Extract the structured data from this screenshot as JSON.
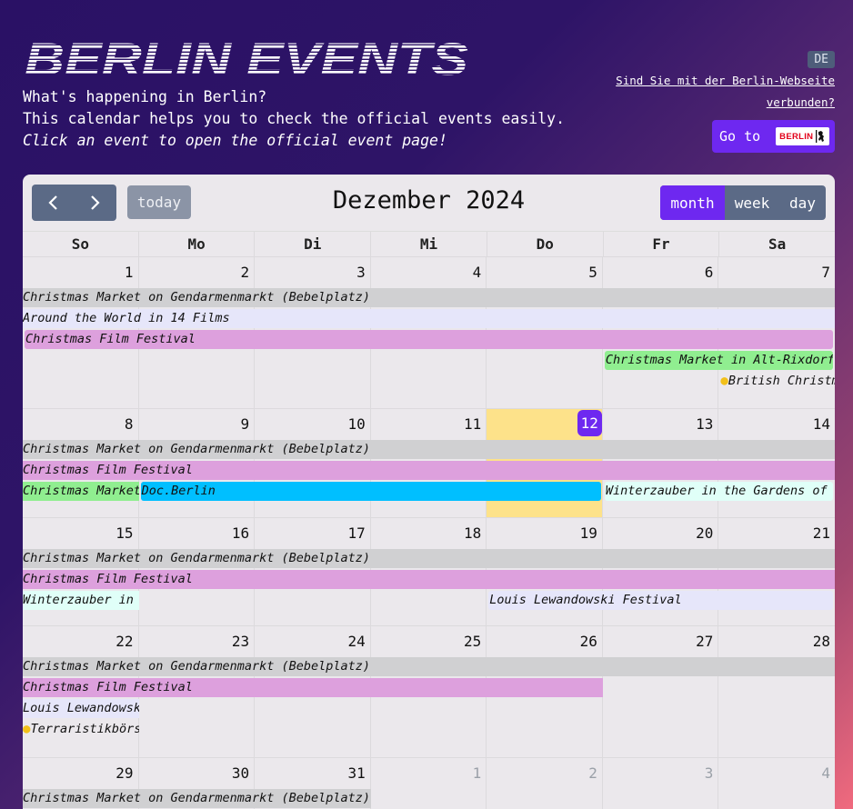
{
  "header": {
    "logo_text": "BERLIN EVENTS",
    "intro_line1": "What's happening in Berlin?",
    "intro_line2": "This calendar helps you to check the official events easily.",
    "intro_line3": "Click an event to open the official event page!",
    "lang": "DE",
    "link_line1": "Sind Sie mit der Berlin-Webseite",
    "link_line2": "verbunden?",
    "goto_label": "Go to",
    "berlin_logo_text": "BERLIN"
  },
  "toolbar": {
    "today_label": "today",
    "title": "Dezember 2024",
    "views": [
      "month",
      "week",
      "day"
    ],
    "active_view": "month"
  },
  "weekdays": [
    "So",
    "Mo",
    "Di",
    "Mi",
    "Do",
    "Fr",
    "Sa"
  ],
  "colors": {
    "accent": "#6e28f0",
    "today_bg": "#fde28a",
    "gray_event": "#d0d0d2",
    "lavender_event": "#e6e6fa",
    "pink_event": "#dda0dd",
    "green_event": "#90ee90",
    "blue_event": "#00bfff",
    "mint_event": "#e0fff8"
  },
  "weeks": [
    {
      "days": [
        {
          "num": "1"
        },
        {
          "num": "2"
        },
        {
          "num": "3"
        },
        {
          "num": "4"
        },
        {
          "num": "5"
        },
        {
          "num": "6"
        },
        {
          "num": "7"
        }
      ],
      "events": [
        {
          "title": "Christmas Market on Gendarmenmarkt (Bebelplatz)",
          "start": 0,
          "end": 7,
          "row": 0,
          "color": "#d0d0d2"
        },
        {
          "title": "Around the World in 14 Films",
          "start": 0,
          "end": 7,
          "row": 1,
          "color": "#e6e6fa"
        },
        {
          "title": "Christmas Film Festival",
          "start": 0,
          "end": 7,
          "row": 2,
          "color": "#dda0dd",
          "inset": true
        },
        {
          "title": "Christmas Market in Alt-Rixdorf",
          "start": 5,
          "end": 7,
          "row": 3,
          "color": "#90ee90",
          "inset": true
        },
        {
          "title": "British Christmas Fair",
          "start": 6,
          "end": 7,
          "row": 4,
          "color": "transparent",
          "dot": true
        }
      ]
    },
    {
      "days": [
        {
          "num": "8"
        },
        {
          "num": "9"
        },
        {
          "num": "10"
        },
        {
          "num": "11"
        },
        {
          "num": "12",
          "today": true
        },
        {
          "num": "13"
        },
        {
          "num": "14"
        }
      ],
      "events": [
        {
          "title": "Christmas Market on Gendarmenmarkt (Bebelplatz)",
          "start": 0,
          "end": 7,
          "row": 0,
          "color": "#d0d0d2"
        },
        {
          "title": "Christmas Film Festival",
          "start": 0,
          "end": 7,
          "row": 1,
          "color": "#dda0dd"
        },
        {
          "title": "Christmas Market in Alt-Rixdorf",
          "start": 0,
          "end": 1,
          "row": 2,
          "color": "#90ee90"
        },
        {
          "title": "Doc.Berlin",
          "start": 1,
          "end": 5,
          "row": 2,
          "color": "#00bfff",
          "inset": true
        },
        {
          "title": "Winterzauber in the Gardens of the World",
          "start": 5,
          "end": 7,
          "row": 2,
          "color": "#e0fff8",
          "inset": true
        }
      ]
    },
    {
      "days": [
        {
          "num": "15"
        },
        {
          "num": "16"
        },
        {
          "num": "17"
        },
        {
          "num": "18"
        },
        {
          "num": "19"
        },
        {
          "num": "20"
        },
        {
          "num": "21"
        }
      ],
      "events": [
        {
          "title": "Christmas Market on Gendarmenmarkt (Bebelplatz)",
          "start": 0,
          "end": 7,
          "row": 0,
          "color": "#d0d0d2"
        },
        {
          "title": "Christmas Film Festival",
          "start": 0,
          "end": 7,
          "row": 1,
          "color": "#dda0dd"
        },
        {
          "title": "Winterzauber in the Gardens of the World",
          "start": 0,
          "end": 1,
          "row": 2,
          "color": "#e0fff8"
        },
        {
          "title": "Louis Lewandowski Festival",
          "start": 4,
          "end": 7,
          "row": 2,
          "color": "#e6e6fa",
          "inset": true
        }
      ]
    },
    {
      "days": [
        {
          "num": "22"
        },
        {
          "num": "23"
        },
        {
          "num": "24"
        },
        {
          "num": "25"
        },
        {
          "num": "26"
        },
        {
          "num": "27"
        },
        {
          "num": "28"
        }
      ],
      "events": [
        {
          "title": "Christmas Market on Gendarmenmarkt (Bebelplatz)",
          "start": 0,
          "end": 7,
          "row": 0,
          "color": "#d0d0d2"
        },
        {
          "title": "Christmas Film Festival",
          "start": 0,
          "end": 5,
          "row": 1,
          "color": "#dda0dd"
        },
        {
          "title": "Louis Lewandowski Festival",
          "start": 0,
          "end": 1,
          "row": 2,
          "color": "#e6e6fa"
        },
        {
          "title": "Terraristikbörse",
          "start": 0,
          "end": 1,
          "row": 3,
          "color": "transparent",
          "dot": true
        }
      ]
    },
    {
      "days": [
        {
          "num": "29"
        },
        {
          "num": "30"
        },
        {
          "num": "31"
        },
        {
          "num": "1",
          "other": true
        },
        {
          "num": "2",
          "other": true
        },
        {
          "num": "3",
          "other": true
        },
        {
          "num": "4",
          "other": true
        }
      ],
      "events": [
        {
          "title": "Christmas Market on Gendarmenmarkt (Bebelplatz)",
          "start": 0,
          "end": 3,
          "row": 0,
          "color": "#d0d0d2"
        }
      ]
    }
  ]
}
